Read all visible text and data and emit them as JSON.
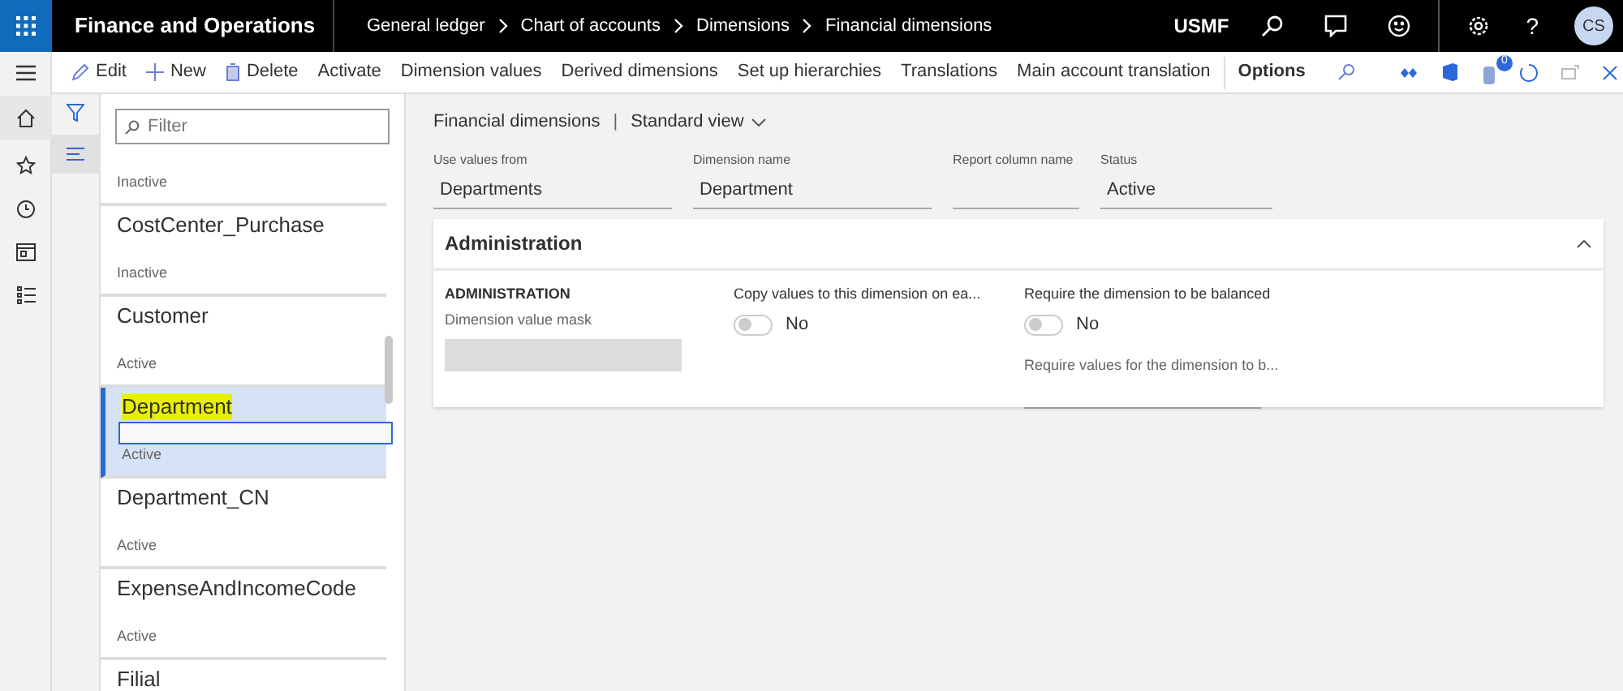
{
  "app_title": "Finance and Operations",
  "breadcrumb": [
    "General ledger",
    "Chart of accounts",
    "Dimensions",
    "Financial dimensions"
  ],
  "company": "USMF",
  "help": "?",
  "avatar": "CS",
  "notification_count": "0",
  "actions": [
    {
      "label": "Edit",
      "kind": "edit"
    },
    {
      "label": "New",
      "kind": "new"
    },
    {
      "label": "Delete",
      "kind": "delete"
    },
    {
      "label": "Activate",
      "kind": "text"
    },
    {
      "label": "Dimension values",
      "kind": "text"
    },
    {
      "label": "Derived dimensions",
      "kind": "text"
    },
    {
      "label": "Set up hierarchies",
      "kind": "text"
    },
    {
      "label": "Translations",
      "kind": "text"
    },
    {
      "label": "Main account translation",
      "kind": "text"
    },
    {
      "label": "Options",
      "kind": "options"
    }
  ],
  "filter": {
    "placeholder": "Filter"
  },
  "list": [
    {
      "status": "Inactive",
      "selected": false
    },
    {
      "name": "CostCenter_Purchase",
      "status": "Inactive",
      "selected": false
    },
    {
      "name": "Customer",
      "status": "Active",
      "selected": false
    },
    {
      "name": "Department",
      "status": "Active",
      "selected": true,
      "highlighted": true
    },
    {
      "name": "Department_CN",
      "status": "Active",
      "selected": false
    },
    {
      "name": "ExpenseAndIncomeCode",
      "status": "Active",
      "selected": false
    },
    {
      "name": "Filial",
      "selected": false
    }
  ],
  "page_title": "Financial dimensions",
  "separator": "|",
  "view": "Standard view",
  "header_fields": [
    {
      "label": "Use values from",
      "value": "Departments"
    },
    {
      "label": "Dimension name",
      "value": "Department"
    },
    {
      "label": "Report column name"
    },
    {
      "label": "Status",
      "value": "Active"
    }
  ],
  "section": {
    "title": "Administration",
    "group_title": "ADMINISTRATION",
    "mask_label": "Dimension value mask",
    "toggles": [
      {
        "label": "Copy values to this dimension on ea...",
        "value": "No",
        "on": false
      },
      {
        "label": "Require the dimension to be balanced",
        "value": "No",
        "on": false
      }
    ],
    "require_label": "Require values for the dimension to b..."
  }
}
